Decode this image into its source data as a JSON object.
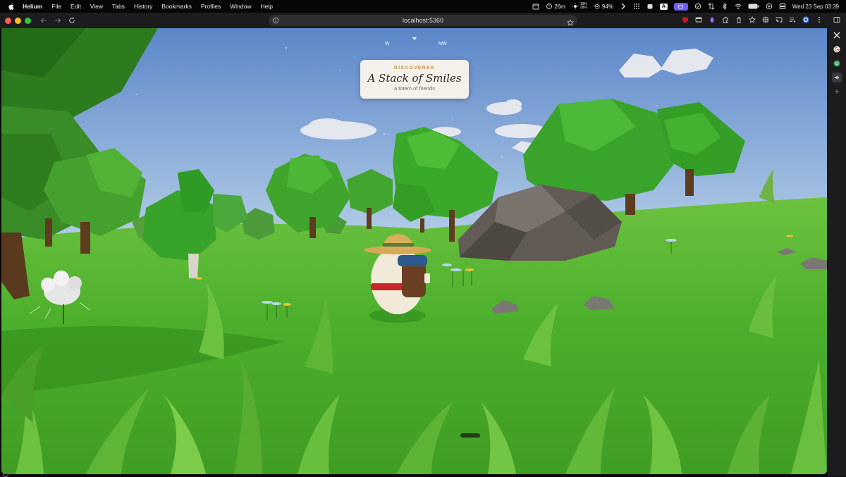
{
  "menubar": {
    "app_name": "Helium",
    "items": [
      "File",
      "Edit",
      "View",
      "Tabs",
      "History",
      "Bookmarks",
      "Profiles",
      "Window",
      "Help"
    ],
    "status": {
      "timer": "26m",
      "temp_top": "19%",
      "temp_bottom": "28%",
      "battery_percent": "94%",
      "badge_letter": "A",
      "datetime": "Wed 23 Sep  03:39"
    }
  },
  "browser": {
    "url": "localhost:5360"
  },
  "game": {
    "compass": {
      "marks": [
        "W",
        "NW"
      ]
    },
    "discovery": {
      "kicker": "DISCOVERED",
      "title": "A Stack of Smiles",
      "subtitle": "a totem of friends"
    }
  },
  "colors": {
    "sky_top": "#5b86c9",
    "sky_bottom": "#bcd4ea",
    "grass": "#4caf2c",
    "grass_dark": "#2f8a1c",
    "foliage": "#3f9e2a",
    "rock": "#615a55",
    "toast_bg": "#f4f1ea",
    "toast_kicker": "#c08a3e"
  }
}
